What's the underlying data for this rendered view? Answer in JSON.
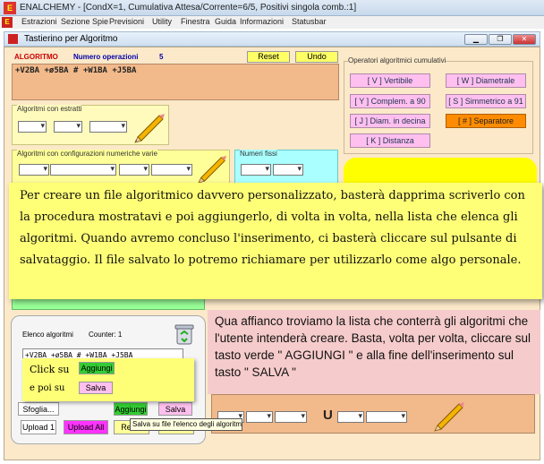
{
  "window": {
    "title": "ENALCHEMY - [CondX=1, Cumulativa Attesa/Corrente=6/5, Positivi singola comb.:1]",
    "app_icon_text": "E"
  },
  "menu": [
    "Estrazioni",
    "Sezione Spie",
    "Previsioni",
    "Utility",
    "Finestra",
    "Guida",
    "Informazioni",
    "Statusbar"
  ],
  "inner_window": {
    "title": "Tastierino per Algoritmo"
  },
  "algo": {
    "label": "ALGORITMO",
    "ops_label": "Numero operazioni",
    "ops_count": "5",
    "reset": "Reset",
    "undo": "Undo",
    "expression": "+V2BA +ø5BA # +W1BA +J5BA"
  },
  "groups": {
    "estratti": "Algoritmi con estratti",
    "numeriche": "Algoritmi con configurazioni numeriche varie",
    "fissi": "Numeri fissi"
  },
  "operators": {
    "title": "Operatori algoritmici cumulativi",
    "buttons": [
      "[ V ] Vertibile",
      "[ W ] Diametrale",
      "[ Y ] Complem. a 90",
      "[ S ] Simmetrico  a 91",
      "[ J ] Diam. in decina",
      "[ # ] Separatore",
      "[ K ] Distanza"
    ]
  },
  "list": {
    "title": "Elenco algoritmi",
    "counter": "Counter: 1",
    "item": "+V2BA +ø5BA # +W1BA +J5BA",
    "click_on": "Click su",
    "then_on": "e poi su",
    "aggiungi": "Aggiungi",
    "salva": "Salva",
    "sfoglia": "Sfoglia...",
    "upload1": "Upload 1",
    "upload_all": "Upload All",
    "reset": "Reset",
    "tooltip": "Salva su file l'elenco degli algoritmi"
  },
  "bottom": {
    "union": "U"
  },
  "notes": {
    "yellow": "Per creare un file algoritmico davvero personalizzato, basterà dapprima scriverlo con la procedura mostratavi e poi aggiungerlo, di volta in volta, nella lista che elenca gli algoritmi. Quando avremo concluso l'inserimento, ci basterà cliccare sul pulsante di salvataggio. Il file salvato lo potremo richiamare per utilizzarlo come algo personale.",
    "pink": "Qua affianco troviamo la lista che conterrà gli algoritmi che l'utente intenderà creare. Basta, volta per volta, cliccare sul tasto verde \" AGGIUNGI \" e alla fine dell'inserimento sul tasto \" SALVA \""
  },
  "colors": {
    "frame_bg": "#fbe9c9",
    "op_button": "#ffc0ef",
    "separator_button": "#ff8c00",
    "green": "#33cc33",
    "magenta": "#ff33ff"
  }
}
